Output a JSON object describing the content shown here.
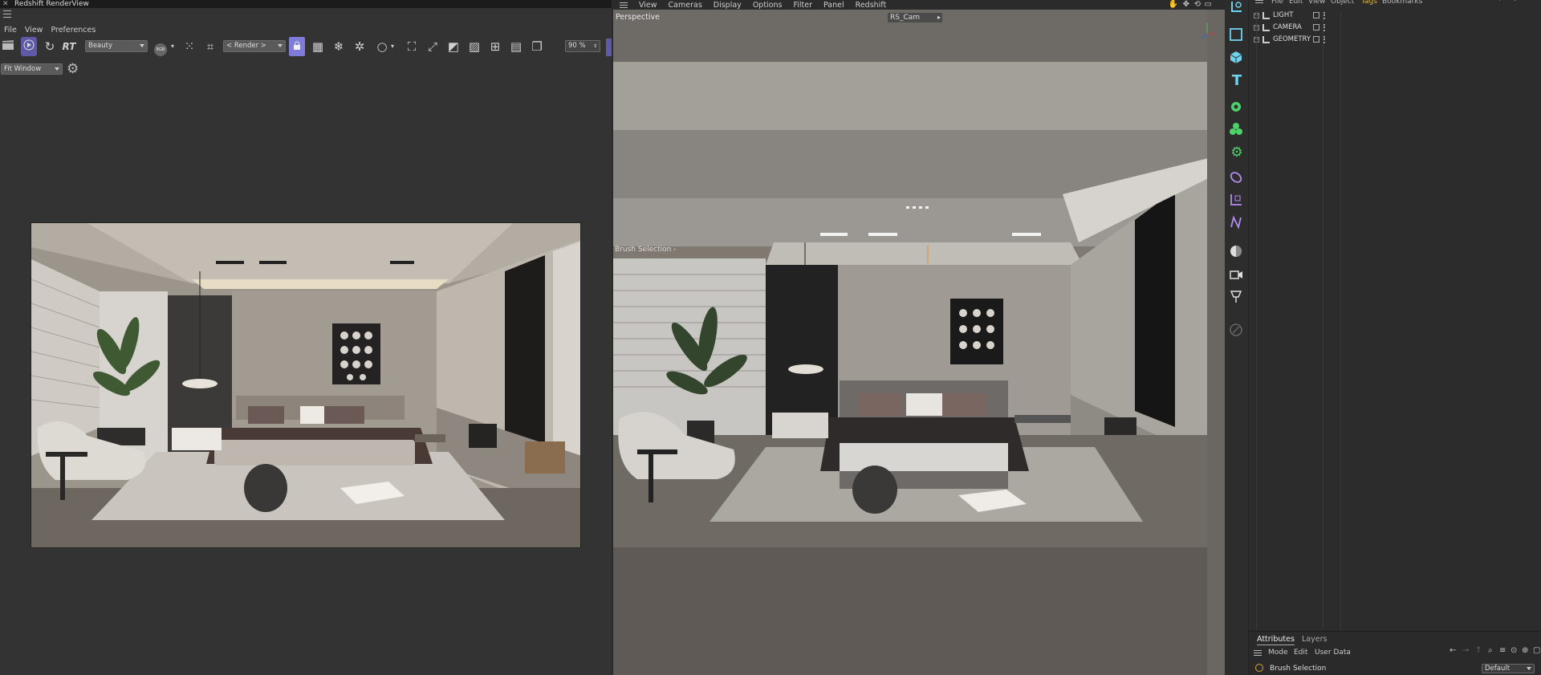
{
  "render_view": {
    "window_title": "Redshift RenderView",
    "menu": [
      "File",
      "View",
      "Preferences"
    ],
    "aov_select": "Beauty",
    "rgb_badge": "RGB",
    "render_select": "< Render >",
    "zoom": "90 %",
    "fit_select": "Fit Window",
    "rt_label": "RT"
  },
  "viewport": {
    "menu": [
      "View",
      "Cameras",
      "Display",
      "Options",
      "Filter",
      "Panel",
      "Redshift"
    ],
    "view_label": "Perspective",
    "camera_select": "RS_Cam",
    "tool_hint": "Brush Selection"
  },
  "object_manager": {
    "menu": [
      "File",
      "Edit",
      "View",
      "Object",
      "Tags",
      "Bookmarks"
    ],
    "objects": [
      {
        "name": "LIGHT"
      },
      {
        "name": "CAMERA"
      },
      {
        "name": "GEOMETRY"
      }
    ]
  },
  "attributes": {
    "tabs": [
      "Attributes",
      "Layers"
    ],
    "menu": [
      "Mode",
      "Edit",
      "User Data"
    ],
    "selection_title": "Brush Selection",
    "preset_select": "Default"
  },
  "colors": {
    "accent": "#7b78d6",
    "icon_cyan": "#6fd3ef",
    "icon_green": "#4dd26b",
    "icon_purple": "#b48cf0"
  }
}
